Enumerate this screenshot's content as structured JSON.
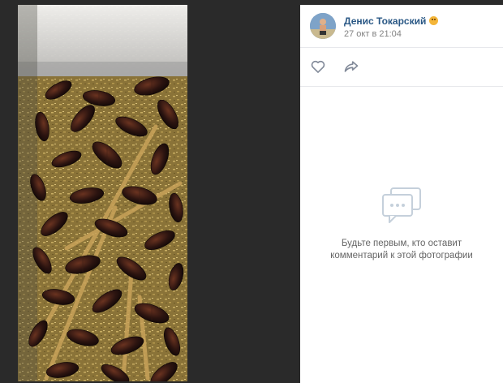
{
  "post": {
    "author": "Денис Токарский",
    "date": "27 окт в 21:04"
  },
  "actions": {
    "like_icon": "heart-icon",
    "share_icon": "share-arrow-icon"
  },
  "comments": {
    "empty_icon": "comments-bubble-icon",
    "empty_line1": "Будьте первым, кто оставит",
    "empty_line2": "комментарий к этой фотографии"
  },
  "colors": {
    "author_link": "#2a5885",
    "muted_text": "#828282",
    "viewer_background": "#2a2a2a",
    "panel_background": "#ffffff"
  }
}
